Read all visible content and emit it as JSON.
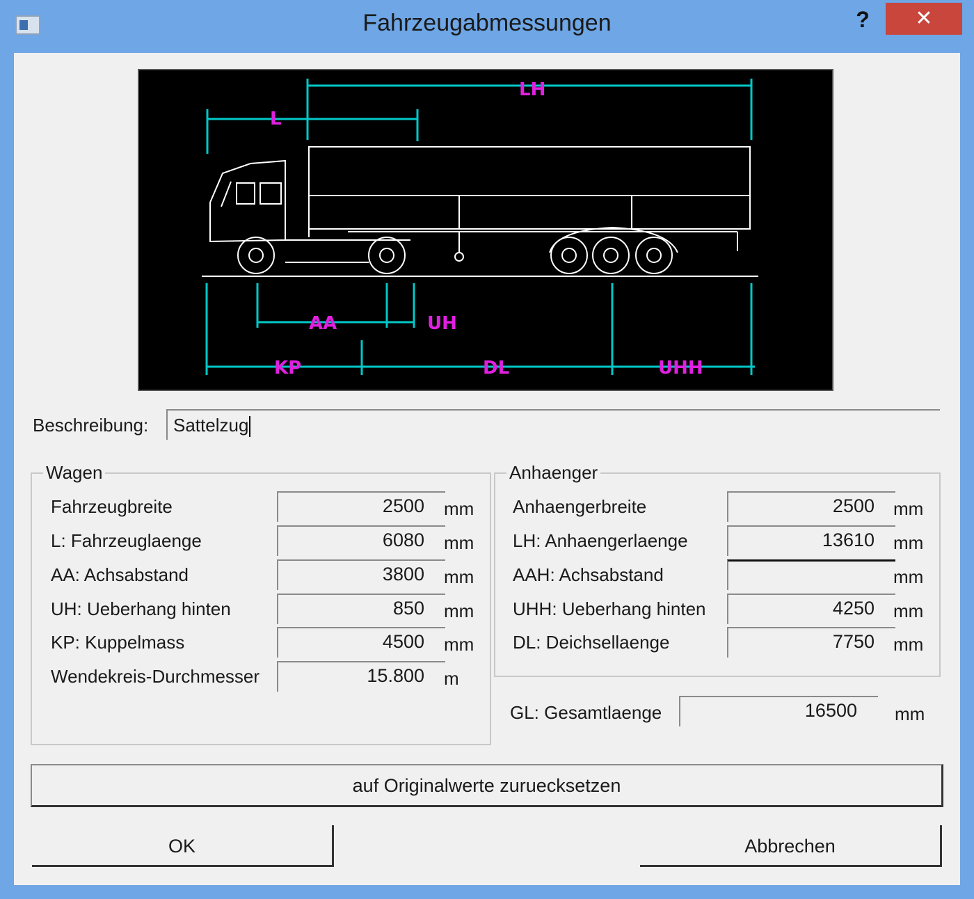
{
  "window": {
    "title": "Fahrzeugabmessungen",
    "help_label": "?",
    "close_label": "✕"
  },
  "diagram": {
    "labels": {
      "lh": "LH",
      "l": "L",
      "aa": "AA",
      "uh": "UH",
      "kp": "KP",
      "dl": "DL",
      "uhh": "UHH"
    },
    "colors": {
      "dimension_lines": "#00c8c8",
      "labels": "#e020e0",
      "vehicle": "#ffffff",
      "background": "#000000"
    }
  },
  "description": {
    "label": "Beschreibung:",
    "value": "Sattelzug"
  },
  "wagen": {
    "title": "Wagen",
    "rows": [
      {
        "label": "Fahrzeugbreite",
        "value": "2500",
        "unit": "mm"
      },
      {
        "label": "L: Fahrzeuglaenge",
        "value": "6080",
        "unit": "mm"
      },
      {
        "label": "AA: Achsabstand",
        "value": "3800",
        "unit": "mm"
      },
      {
        "label": "UH: Ueberhang hinten",
        "value": "850",
        "unit": "mm"
      },
      {
        "label": "KP: Kuppelmass",
        "value": "4500",
        "unit": "mm"
      },
      {
        "label": "Wendekreis-Durchmesser",
        "value": "15.800",
        "unit": "m"
      }
    ]
  },
  "anhaenger": {
    "title": "Anhaenger",
    "rows": [
      {
        "label": "Anhaengerbreite",
        "value": "2500",
        "unit": "mm"
      },
      {
        "label": "LH: Anhaengerlaenge",
        "value": "13610",
        "unit": "mm"
      },
      {
        "label": "AAH: Achsabstand",
        "value": "",
        "unit": "mm"
      },
      {
        "label": "UHH: Ueberhang hinten",
        "value": "4250",
        "unit": "mm"
      },
      {
        "label": "DL: Deichsellaenge",
        "value": "7750",
        "unit": "mm"
      }
    ]
  },
  "gesamt": {
    "label": "GL: Gesamtlaenge",
    "value": "16500",
    "unit": "mm"
  },
  "buttons": {
    "reset": "auf Originalwerte zuruecksetzen",
    "ok": "OK",
    "cancel": "Abbrechen"
  }
}
